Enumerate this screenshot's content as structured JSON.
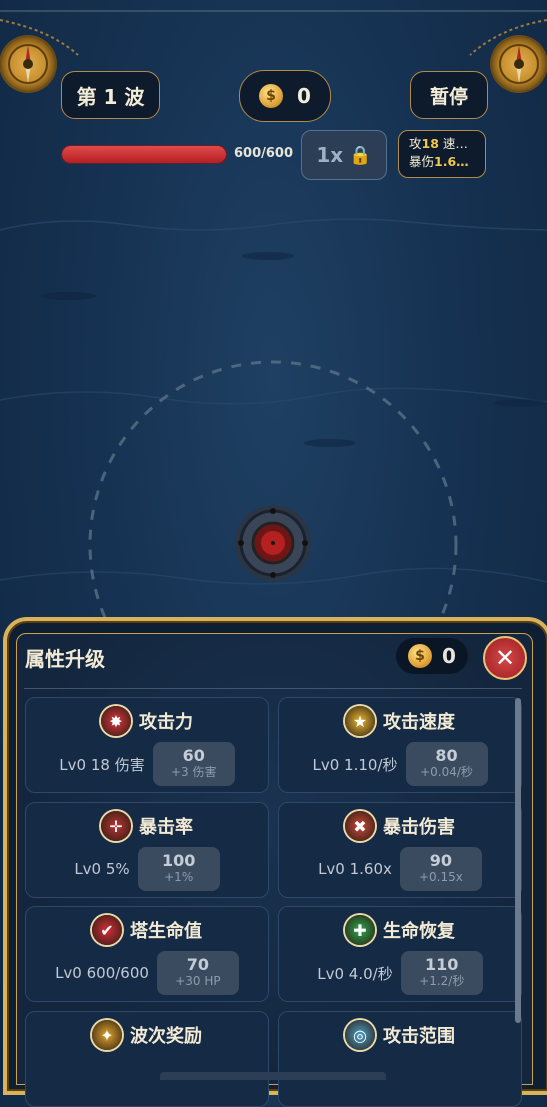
{
  "hud": {
    "wave_label": "第 1 波",
    "gold": "0",
    "pause_label": "暂停",
    "hp_text": "600/600",
    "hp_fraction": 1.0,
    "speed_label": "1x",
    "speed_lock_icon": "lock-icon",
    "stats": {
      "line1_prefix": "攻",
      "line1_value": "18",
      "line1_suffix": " 速…",
      "line2_prefix": "暴伤",
      "line2_value": "1.6…"
    }
  },
  "panel": {
    "title": "属性升级",
    "gold": "0",
    "close_icon": "close-icon",
    "cards": [
      {
        "name": "攻击力",
        "icon": "attack-burst-icon",
        "icon_color": "#d9363e",
        "level": "Lv0 18 伤害",
        "cost": "60",
        "gain": "+3 伤害"
      },
      {
        "name": "攻击速度",
        "icon": "star-icon",
        "icon_color": "#e8b833",
        "level": "Lv0 1.10/秒",
        "cost": "80",
        "gain": "+0.04/秒"
      },
      {
        "name": "暴击率",
        "icon": "crosshair-icon",
        "icon_color": "#b83535",
        "level": "Lv0 5%",
        "cost": "100",
        "gain": "+1%"
      },
      {
        "name": "暴击伤害",
        "icon": "crit-damage-icon",
        "icon_color": "#c84a3a",
        "level": "Lv0 1.60x",
        "cost": "90",
        "gain": "+0.15x"
      },
      {
        "name": "塔生命值",
        "icon": "heart-check-icon",
        "icon_color": "#d42f3a",
        "level": "Lv0 600/600",
        "cost": "70",
        "gain": "+30 HP"
      },
      {
        "name": "生命恢复",
        "icon": "plus-heal-icon",
        "icon_color": "#2fa84f",
        "level": "Lv0 4.0/秒",
        "cost": "110",
        "gain": "+1.2/秒"
      },
      {
        "name": "波次奖励",
        "icon": "wave-reward-icon",
        "icon_color": "#e0a52c",
        "level": "",
        "cost": "",
        "gain": ""
      },
      {
        "name": "攻击范围",
        "icon": "range-target-icon",
        "icon_color": "#4aa0c8",
        "level": "",
        "cost": "",
        "gain": ""
      }
    ]
  },
  "colors": {
    "accent_gold": "#d9b35c",
    "hp_red": "#d93a3a",
    "background": "#163252"
  }
}
